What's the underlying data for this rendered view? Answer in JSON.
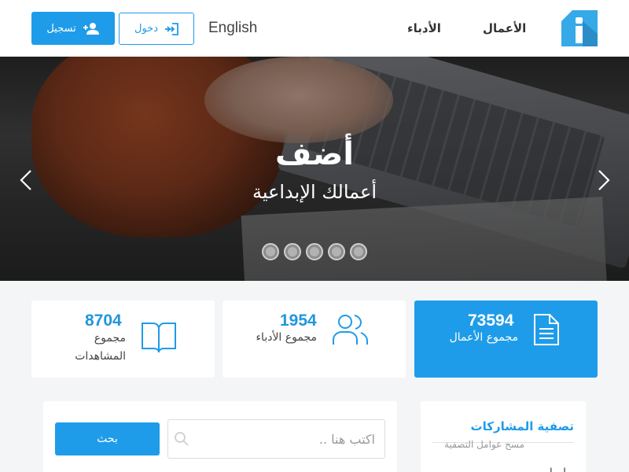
{
  "header": {
    "nav": {
      "works": "الأعمال",
      "writers": "الأدباء"
    },
    "language": "English",
    "login_label": "دخول",
    "register_label": "تسجيل"
  },
  "hero": {
    "title": "أضف",
    "subtitle": "أعمالك الإبداعية",
    "slide_count": 5
  },
  "stats": {
    "works": {
      "value": "73594",
      "label": "مجموع الأعمال",
      "icon": "document-icon"
    },
    "writers": {
      "value": "1954",
      "label": "مجموع الأدباء",
      "icon": "users-icon"
    },
    "views": {
      "value": "8704",
      "label_line1": "مجموع",
      "label_line2": "المشاهدات",
      "icon": "open-book-icon"
    }
  },
  "search": {
    "placeholder": "اكتب هنا ..",
    "button_label": "بحث"
  },
  "filter": {
    "title": "تصفية المشاركات",
    "clear_label": "مسح عوامل التصفية",
    "next_label": "ا...ا"
  },
  "colors": {
    "accent": "#1e9ce9",
    "logo": "#36a9e8"
  }
}
